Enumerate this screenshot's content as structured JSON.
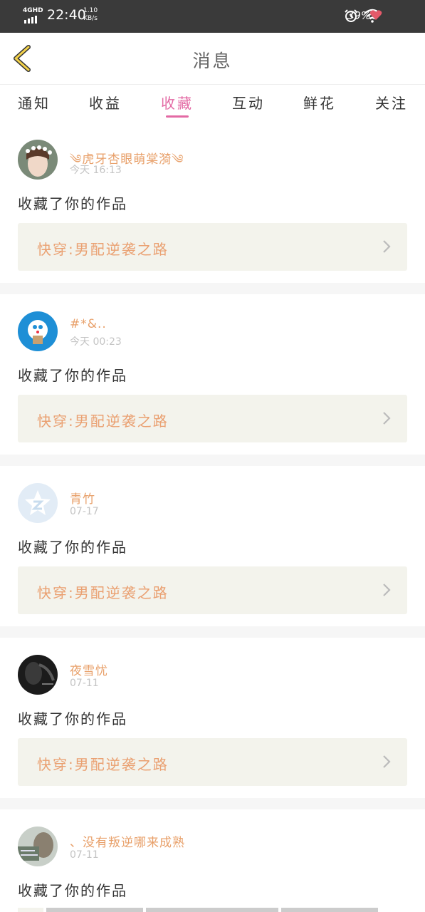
{
  "status_bar": {
    "network": "4GHD",
    "time": "22:40",
    "speed_value": "1.10",
    "speed_unit": "KB/s",
    "battery": "39%"
  },
  "header": {
    "title": "消息"
  },
  "tabs": [
    {
      "label": "通知",
      "active": false
    },
    {
      "label": "收益",
      "active": false
    },
    {
      "label": "收藏",
      "active": true
    },
    {
      "label": "互动",
      "active": false
    },
    {
      "label": "鲜花",
      "active": false
    },
    {
      "label": "关注",
      "active": false
    }
  ],
  "messages": [
    {
      "user": "༄虎牙杏眼萌棠漪༄",
      "date": "今天 16:13",
      "action": "收藏了你的作品",
      "work": "快穿:男配逆袭之路"
    },
    {
      "user": "#*&..",
      "date": "今天 00:23",
      "action": "收藏了你的作品",
      "work": "快穿:男配逆袭之路"
    },
    {
      "user": "青竹",
      "date": "07-17",
      "action": "收藏了你的作品",
      "work": "快穿:男配逆袭之路"
    },
    {
      "user": "夜雪忧",
      "date": "07-11",
      "action": "收藏了你的作品",
      "work": "快穿:男配逆袭之路"
    },
    {
      "user": "、没有叛逆哪来成熟",
      "date": "07-11",
      "action": "收藏了你的作品"
    }
  ]
}
